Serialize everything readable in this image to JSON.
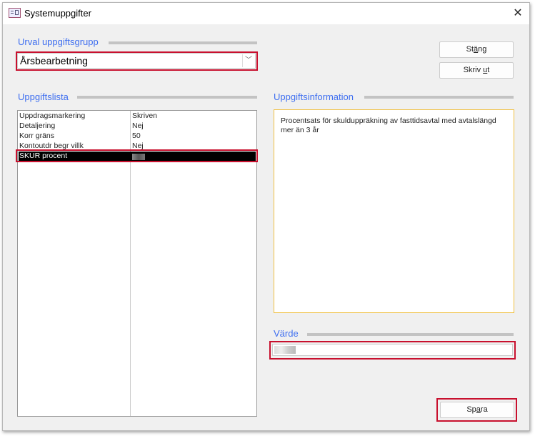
{
  "window": {
    "title": "Systemuppgifter",
    "close_icon": "close-icon"
  },
  "group": {
    "label": "Urval uppgiftsgrupp",
    "selected": "Årsbearbetning"
  },
  "buttons": {
    "close_pre": "St",
    "close_u": "ä",
    "close_post": "ng",
    "print_pre": "Skriv ",
    "print_u": "u",
    "print_post": "t",
    "save_pre": "Sp",
    "save_u": "a",
    "save_post": "ra"
  },
  "tasklist": {
    "label": "Uppgiftslista",
    "rows": [
      {
        "name": "Uppdragsmarkering",
        "value": "Skriven"
      },
      {
        "name": "Detaljering",
        "value": "Nej"
      },
      {
        "name": "Korr gräns",
        "value": "50"
      },
      {
        "name": "Kontoutdr begr villk",
        "value": "Nej"
      },
      {
        "name": "SKUR procent",
        "value": "",
        "selected": true
      }
    ]
  },
  "info": {
    "label": "Uppgiftsinformation",
    "text": "Procentsats för skulduppräkning av fasttidsavtal med avtalslängd mer än 3 år"
  },
  "value": {
    "label": "Värde",
    "value": ""
  },
  "colors": {
    "accent_label": "#3f6ff0",
    "highlight": "#c8102e",
    "info_border": "#f0c040"
  }
}
